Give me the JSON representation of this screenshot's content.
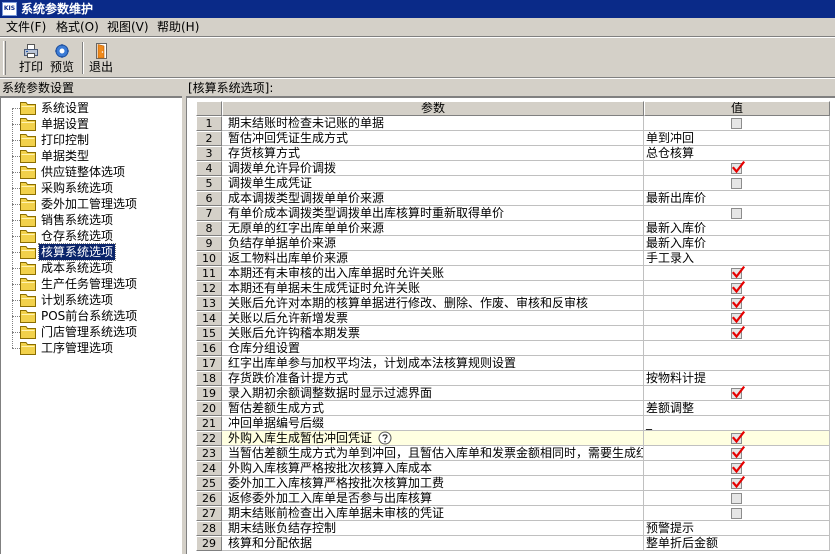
{
  "window": {
    "title": "系统参数维护",
    "app_icon": "kis-app-icon",
    "app_icon_label": "KIS"
  },
  "menu": [
    {
      "label": "文件(F)"
    },
    {
      "label": "格式(O)"
    },
    {
      "label": "视图(V)"
    },
    {
      "label": "帮助(H)"
    }
  ],
  "toolbar": [
    {
      "label": "打印",
      "icon": "print-icon"
    },
    {
      "label": "预览",
      "icon": "preview-icon"
    },
    {
      "label": "退出",
      "icon": "exit-icon"
    }
  ],
  "left_panel": {
    "title": "系统参数设置",
    "items": [
      {
        "label": "系统设置"
      },
      {
        "label": "单据设置"
      },
      {
        "label": "打印控制"
      },
      {
        "label": "单据类型"
      },
      {
        "label": "供应链整体选项"
      },
      {
        "label": "采购系统选项"
      },
      {
        "label": "委外加工管理选项"
      },
      {
        "label": "销售系统选项"
      },
      {
        "label": "仓存系统选项"
      },
      {
        "label": "核算系统选项",
        "selected": true
      },
      {
        "label": "成本系统选项"
      },
      {
        "label": "生产任务管理选项"
      },
      {
        "label": "计划系统选项"
      },
      {
        "label": "POS前台系统选项"
      },
      {
        "label": "门店管理系统选项"
      },
      {
        "label": "工序管理选项"
      }
    ]
  },
  "right_panel": {
    "title": "[核算系统选项]:",
    "columns": {
      "param": "参数",
      "value": "值"
    },
    "rows": [
      {
        "no": "1",
        "param": "期末结账时检查未记账的单据",
        "checked": false
      },
      {
        "no": "2",
        "param": "暂估冲回凭证生成方式",
        "value": "单到冲回"
      },
      {
        "no": "3",
        "param": "存货核算方式",
        "value": "总仓核算"
      },
      {
        "no": "4",
        "param": "调拨单允许异价调拨",
        "checked": true
      },
      {
        "no": "5",
        "param": "调拨单生成凭证",
        "checked": false
      },
      {
        "no": "6",
        "param": "成本调拨类型调拨单单价来源",
        "value": "最新出库价"
      },
      {
        "no": "7",
        "param": "有单价成本调拨类型调拨单出库核算时重新取得单价",
        "checked": false
      },
      {
        "no": "8",
        "param": "无原单的红字出库单单价来源",
        "value": "最新入库价"
      },
      {
        "no": "9",
        "param": "负结存单据单价来源",
        "value": "最新入库价"
      },
      {
        "no": "10",
        "param": "返工物料出库单价来源",
        "value": "手工录入"
      },
      {
        "no": "11",
        "param": "本期还有未审核的出入库单据时允许关账",
        "checked": true
      },
      {
        "no": "12",
        "param": "本期还有单据未生成凭证时允许关账",
        "checked": true
      },
      {
        "no": "13",
        "param": "关账后允许对本期的核算单据进行修改、删除、作废、审核和反审核",
        "checked": true
      },
      {
        "no": "14",
        "param": "关账以后允许新增发票",
        "checked": true
      },
      {
        "no": "15",
        "param": "关账后允许钩稽本期发票",
        "checked": true
      },
      {
        "no": "16",
        "param": "仓库分组设置",
        "value": ""
      },
      {
        "no": "17",
        "param": "红字出库单参与加权平均法，计划成本法核算规则设置",
        "value": ""
      },
      {
        "no": "18",
        "param": "存货跌价准备计提方式",
        "value": "按物料计提"
      },
      {
        "no": "19",
        "param": "录入期初余额调整数据时显示过滤界面",
        "checked": true
      },
      {
        "no": "20",
        "param": "暂估差额生成方式",
        "value": "差额调整"
      },
      {
        "no": "21",
        "param": "冲回单据编号后缀",
        "value": "_"
      },
      {
        "no": "22",
        "param": "外购入库生成暂估冲回凭证",
        "checked": true,
        "help": true,
        "highlighted": true
      },
      {
        "no": "23",
        "param": "当暂估差额生成方式为单到冲回，且暂估入库单和发票金额相同时，需要生成红",
        "checked": true
      },
      {
        "no": "24",
        "param": "外购入库核算严格按批次核算入库成本",
        "checked": true
      },
      {
        "no": "25",
        "param": "委外加工入库核算严格按批次核算加工费",
        "checked": true
      },
      {
        "no": "26",
        "param": "返修委外加工入库单是否参与出库核算",
        "checked": false
      },
      {
        "no": "27",
        "param": "期末结账前检查出入库单据未审核的凭证",
        "checked": false
      },
      {
        "no": "28",
        "param": "期末结账负结存控制",
        "value": "预警提示"
      },
      {
        "no": "29",
        "param": "核算和分配依据",
        "value": "整单折后金额"
      }
    ]
  },
  "colors": {
    "title_bar": "#0a2a88",
    "selection_bg": "#0a246a",
    "highlight_row_bg": "#ffffe1",
    "check_mark": "#e60000"
  }
}
